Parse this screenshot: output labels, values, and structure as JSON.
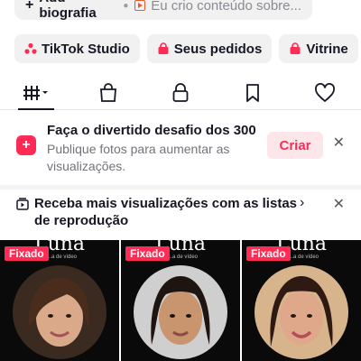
{
  "bio": {
    "add_label": "Add biografia",
    "hint": "Eu crio conteúdo sobre..."
  },
  "chips": [
    {
      "label": "TikTok Studio",
      "icon": "studio-icon"
    },
    {
      "label": "Seus pedidos",
      "icon": "bag-icon"
    },
    {
      "label": "Vitrine",
      "icon": "shop-icon"
    }
  ],
  "tabs": [
    "videos-grid",
    "shop",
    "private",
    "saved",
    "liked"
  ],
  "challenge": {
    "title": "Faça o divertido desafio dos 300",
    "subtitle": "Publique fotos para aumentar as visualizações.",
    "button": "Criar"
  },
  "playlist": {
    "title": "Receba mais visualizações com as listas de reprodução"
  },
  "videos": [
    {
      "brand": "Luna",
      "tag": "...a de vídeo",
      "pinned": "Fixado"
    },
    {
      "brand": "Luna",
      "tag": "...a de vídeo",
      "pinned": "Fixado"
    },
    {
      "brand": "Luna",
      "tag": "...a de vídeo",
      "pinned": "Fixado"
    }
  ],
  "colors": {
    "accent": "#fe2c55",
    "text": "#161823",
    "muted": "#73747b"
  }
}
